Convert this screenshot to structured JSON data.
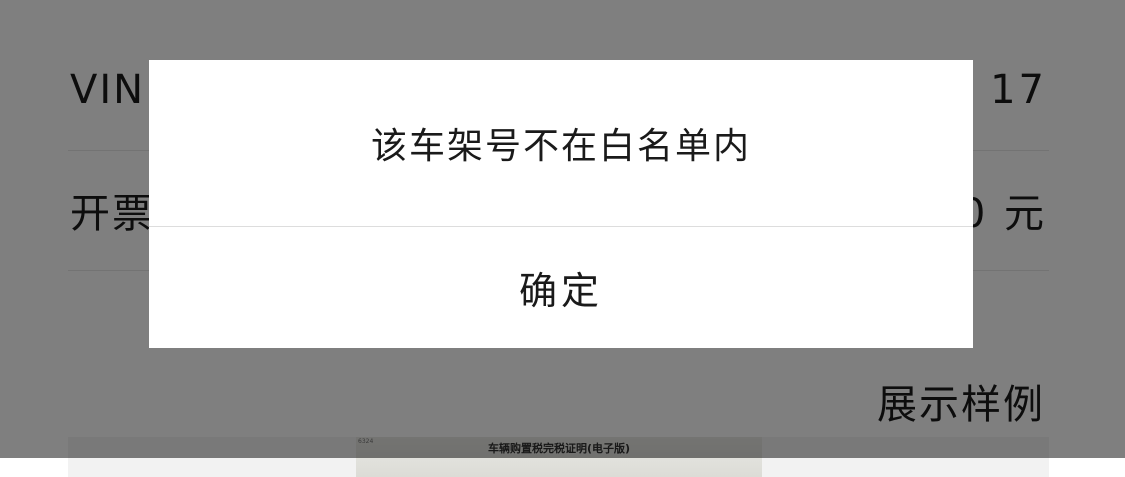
{
  "form": {
    "vin_label": "VIN",
    "vin_value_visible": "17",
    "amount_label": "开票",
    "amount_value_visible": "0 元"
  },
  "sample": {
    "label": "展示样例",
    "image_title": "车辆购置税完税证明(电子版)",
    "image_corner_text": "6324"
  },
  "dialog": {
    "message": "该车架号不在白名单内",
    "confirm_label": "确定"
  }
}
